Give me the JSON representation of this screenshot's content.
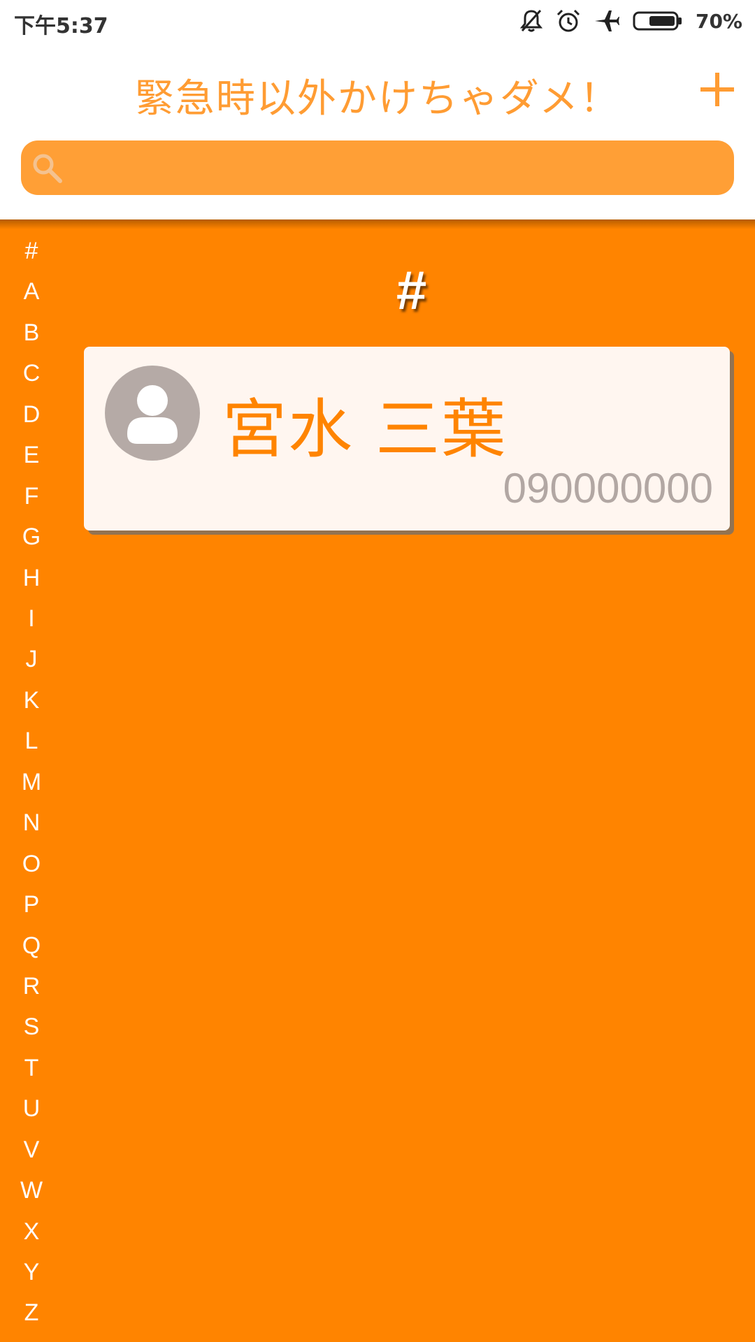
{
  "status_bar": {
    "time": "下午5:37",
    "battery_percent": "70%",
    "icons": [
      "bell-off-icon",
      "alarm-icon",
      "airplane-icon",
      "battery-icon"
    ]
  },
  "header": {
    "title": "緊急時以外かけちゃダメ！",
    "add_icon": "plus-icon"
  },
  "search": {
    "placeholder": "",
    "value": "",
    "icon": "search-icon"
  },
  "index": {
    "letters": [
      "#",
      "A",
      "B",
      "C",
      "D",
      "E",
      "F",
      "G",
      "H",
      "I",
      "J",
      "K",
      "L",
      "M",
      "N",
      "O",
      "P",
      "Q",
      "R",
      "S",
      "T",
      "U",
      "V",
      "W",
      "X",
      "Y",
      "Z"
    ]
  },
  "contacts": {
    "section_header": "#",
    "items": [
      {
        "name": "宮水 三葉",
        "phone": "090000000",
        "avatar_icon": "person-avatar-icon"
      }
    ]
  },
  "colors": {
    "accent": "#ff8400",
    "title": "#ff9c33",
    "search_bg": "#ff9f36",
    "card_bg": "#fff6f0",
    "phone_text": "#b2a7a3",
    "avatar": "#b5aaa6"
  }
}
